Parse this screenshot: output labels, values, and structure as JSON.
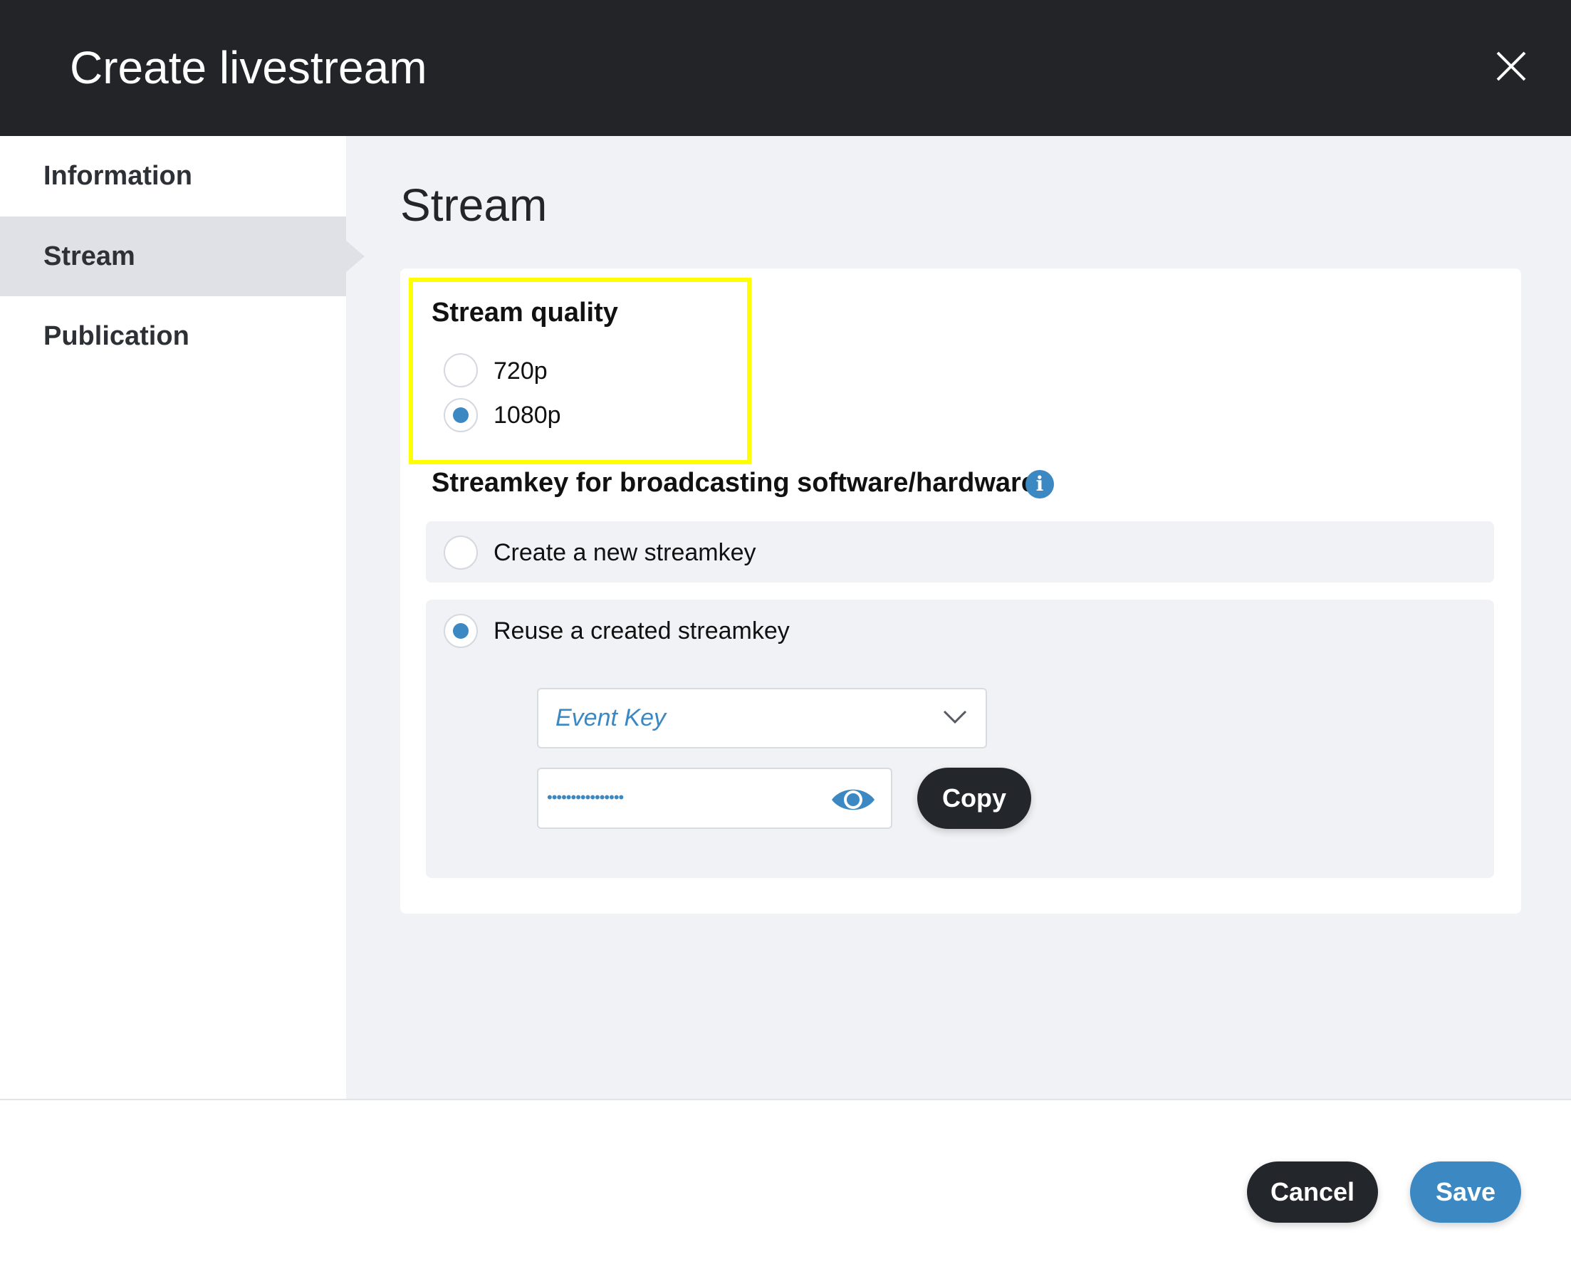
{
  "dialog": {
    "title": "Create livestream"
  },
  "sidebar": {
    "items": [
      {
        "label": "Information",
        "active": false
      },
      {
        "label": "Stream",
        "active": true
      },
      {
        "label": "Publication",
        "active": false
      }
    ]
  },
  "section": {
    "title": "Stream"
  },
  "stream_quality": {
    "label": "Stream quality",
    "options": [
      {
        "label": "720p",
        "selected": false
      },
      {
        "label": "1080p",
        "selected": true
      }
    ]
  },
  "streamkey": {
    "label": "Streamkey for broadcasting software/hardware",
    "info_icon": "info-icon",
    "options": [
      {
        "label": "Create a new streamkey",
        "selected": false
      },
      {
        "label": "Reuse a created streamkey",
        "selected": true
      }
    ],
    "select_value": "Event Key",
    "key_masked": "••••••••••••••••",
    "copy_label": "Copy"
  },
  "footer": {
    "cancel_label": "Cancel",
    "save_label": "Save"
  },
  "colors": {
    "header_bg": "#222428",
    "accent": "#3b88c3",
    "dark_button": "#23262b",
    "content_bg": "#f0f2f5",
    "highlight": "#ffff00"
  }
}
